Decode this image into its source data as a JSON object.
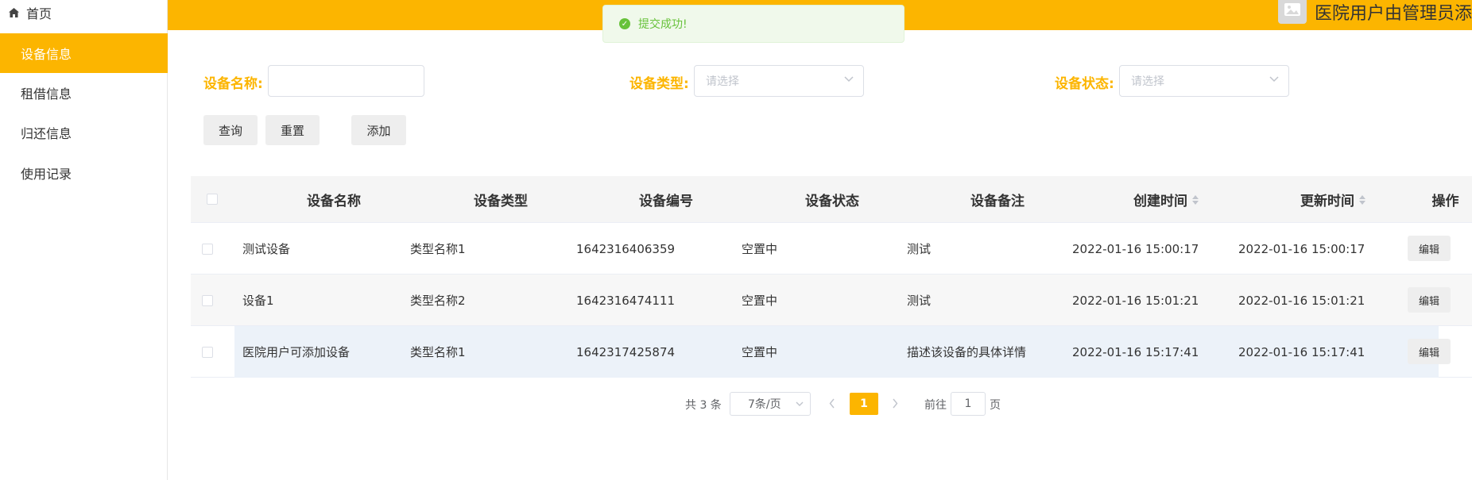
{
  "sidebar": {
    "home_label": "首页",
    "items": [
      {
        "label": "设备信息",
        "active": true
      },
      {
        "label": "租借信息"
      },
      {
        "label": "归还信息"
      },
      {
        "label": "使用记录"
      }
    ]
  },
  "header": {
    "title": "医院用户由管理员添",
    "accent_color": "#FCB500"
  },
  "toast": {
    "message": "提交成功!"
  },
  "search": {
    "name_label": "设备名称:",
    "name_value": "",
    "type_label": "设备类型:",
    "type_placeholder": "请选择",
    "status_label": "设备状态:",
    "status_placeholder": "请选择"
  },
  "buttons": {
    "query": "查询",
    "reset": "重置",
    "add": "添加"
  },
  "table": {
    "columns": [
      "设备名称",
      "设备类型",
      "设备编号",
      "设备状态",
      "设备备注",
      "创建时间",
      "更新时间",
      "操作"
    ],
    "rows": [
      {
        "name": "测试设备",
        "type": "类型名称1",
        "code": "1642316406359",
        "status": "空置中",
        "remark": "测试",
        "created": "2022-01-16 15:00:17",
        "updated": "2022-01-16 15:00:17",
        "action": "编辑"
      },
      {
        "name": "设备1",
        "type": "类型名称2",
        "code": "1642316474111",
        "status": "空置中",
        "remark": "测试",
        "created": "2022-01-16 15:01:21",
        "updated": "2022-01-16 15:01:21",
        "action": "编辑"
      },
      {
        "name": "医院用户可添加设备",
        "type": "类型名称1",
        "code": "1642317425874",
        "status": "空置中",
        "remark": "描述该设备的具体详情",
        "created": "2022-01-16 15:17:41",
        "updated": "2022-01-16 15:17:41",
        "action": "编辑"
      }
    ]
  },
  "pagination": {
    "total": "共 3 条",
    "page_size": "7条/页",
    "current_page": "1",
    "goto_prefix": "前往",
    "goto_value": "1",
    "goto_suffix": "页"
  }
}
